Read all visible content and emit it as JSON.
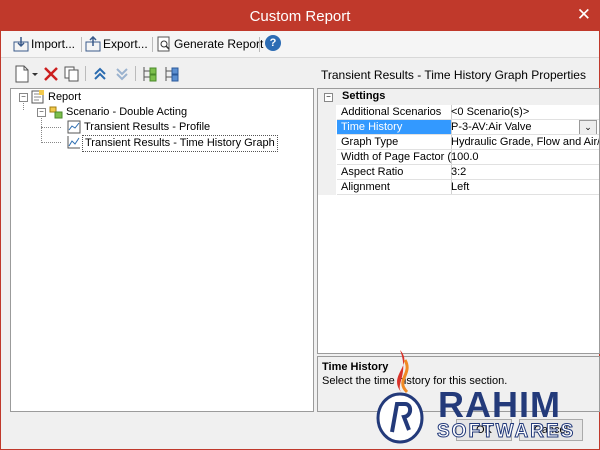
{
  "window": {
    "title": "Custom Report",
    "close_glyph": "✕"
  },
  "toolbar": {
    "import_label": "Import...",
    "export_label": "Export...",
    "generate_label": "Generate Report",
    "help_glyph": "?"
  },
  "tree": {
    "root": "Report",
    "scenario": "Scenario - Double Acting",
    "items": [
      {
        "label": "Transient Results - Profile"
      },
      {
        "label": "Transient Results - Time History Graph"
      }
    ]
  },
  "properties": {
    "title": "Transient Results - Time History Graph Properties",
    "category": "Settings",
    "rows": [
      {
        "name": "Additional Scenarios",
        "value": "<0 Scenario(s)>"
      },
      {
        "name": "Time History",
        "value": "P-3-AV:Air Valve"
      },
      {
        "name": "Graph Type",
        "value": "Hydraulic Grade, Flow and Air/V"
      },
      {
        "name": "Width of Page Factor (%)",
        "value": "100.0"
      },
      {
        "name": "Aspect Ratio",
        "value": "3:2"
      },
      {
        "name": "Alignment",
        "value": "Left"
      }
    ],
    "description": {
      "heading": "Time History",
      "text": "Select the time history for this section."
    }
  },
  "footer": {
    "ok_label": "OK",
    "cancel_label": "Cancel"
  },
  "watermark": {
    "name": "RAHIM",
    "sub": "SOFTWARES"
  },
  "colors": {
    "titlebar": "#c0392b",
    "selection": "#3399ff",
    "watermark": "#233a7a"
  }
}
